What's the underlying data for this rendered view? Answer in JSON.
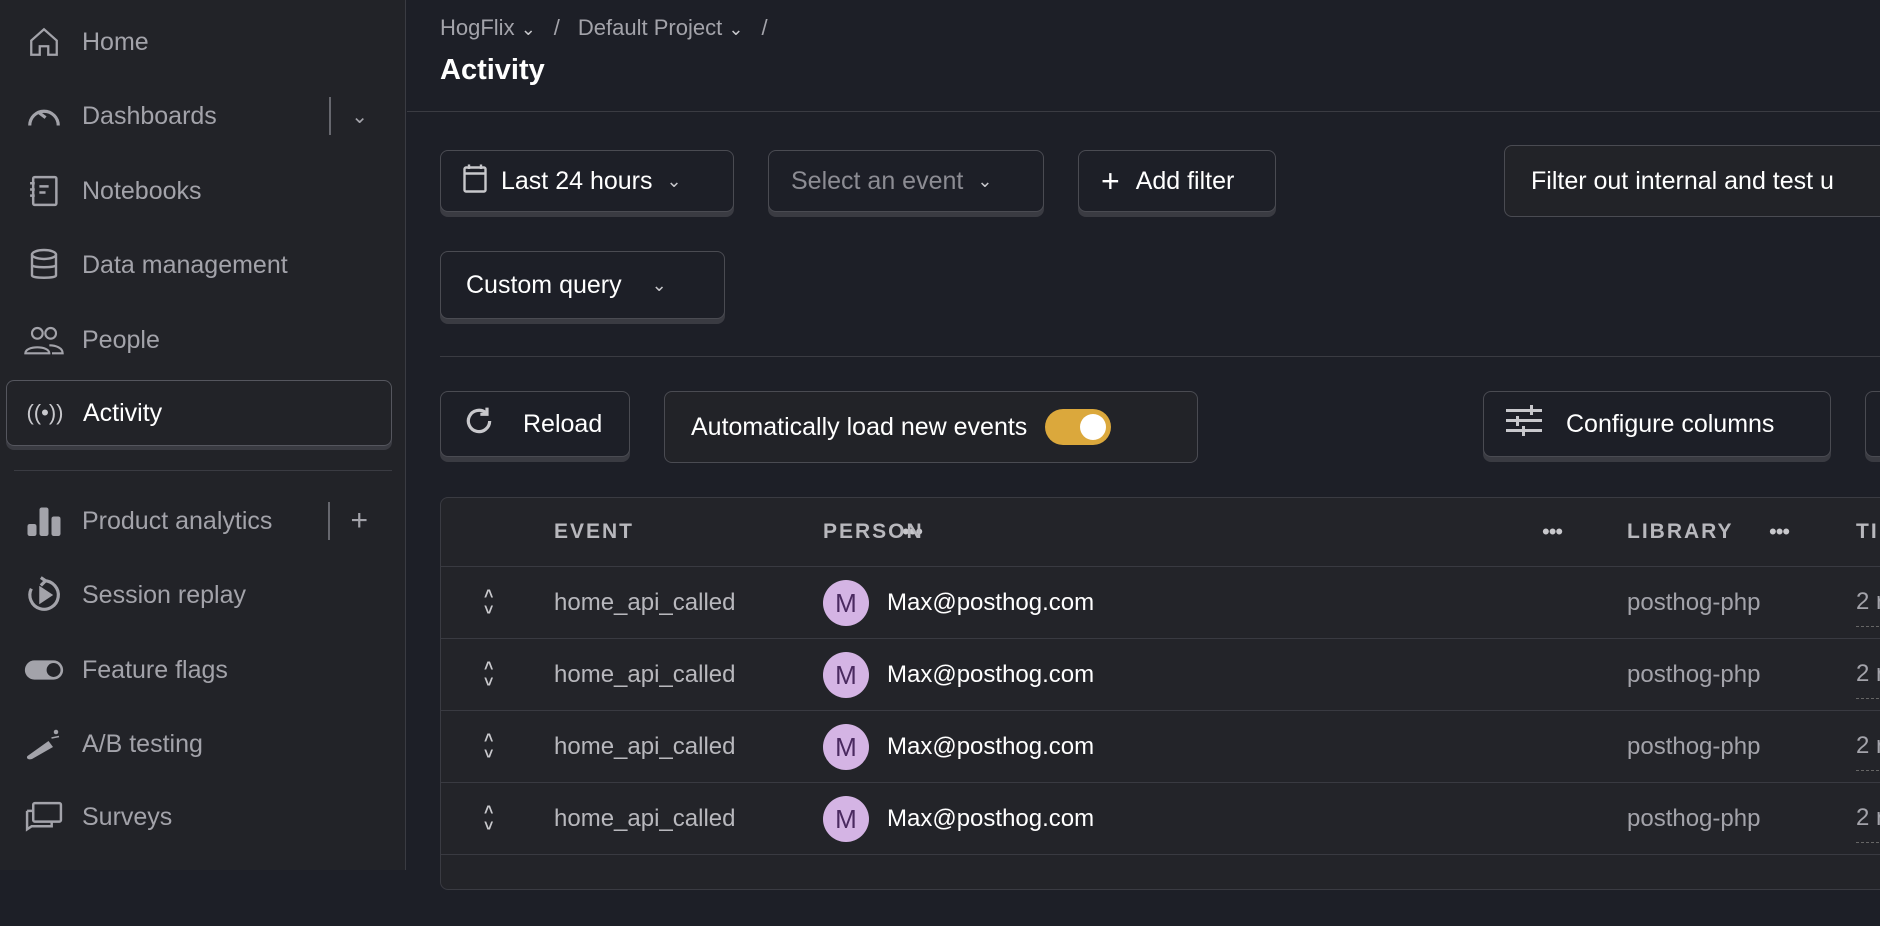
{
  "sidebar": {
    "items": [
      {
        "label": "Home",
        "icon": "home-icon"
      },
      {
        "label": "Dashboards",
        "icon": "gauge-icon"
      },
      {
        "label": "Notebooks",
        "icon": "notebook-icon"
      },
      {
        "label": "Data management",
        "icon": "database-icon"
      },
      {
        "label": "People",
        "icon": "people-icon"
      },
      {
        "label": "Activity",
        "icon": "broadcast-icon",
        "active": true
      },
      {
        "label": "Product analytics",
        "icon": "bar-chart-icon"
      },
      {
        "label": "Session replay",
        "icon": "replay-icon"
      },
      {
        "label": "Feature flags",
        "icon": "toggle-icon"
      },
      {
        "label": "A/B testing",
        "icon": "flask-icon"
      },
      {
        "label": "Surveys",
        "icon": "chat-icon"
      }
    ]
  },
  "header": {
    "breadcrumbs": [
      "HogFlix",
      "Default Project"
    ],
    "separator": "/",
    "title": "Activity"
  },
  "filters": {
    "date_range": "Last 24 hours",
    "event_placeholder": "Select an event",
    "add_filter": "Add filter",
    "internal_filter": "Filter out internal and test u",
    "query_type": "Custom query"
  },
  "toolbar": {
    "reload": "Reload",
    "auto_load": "Automatically load new events",
    "auto_load_on": true,
    "configure_columns": "Configure columns"
  },
  "colors": {
    "accent": "#dba83c",
    "avatar": "#d4b4e4"
  },
  "table": {
    "columns": [
      "EVENT",
      "PERSON",
      "LIBRARY",
      "TI"
    ],
    "rows": [
      {
        "event": "home_api_called",
        "avatar": "M",
        "person": "Max@posthog.com",
        "library": "posthog-php",
        "time": "2 r"
      },
      {
        "event": "home_api_called",
        "avatar": "M",
        "person": "Max@posthog.com",
        "library": "posthog-php",
        "time": "2 r"
      },
      {
        "event": "home_api_called",
        "avatar": "M",
        "person": "Max@posthog.com",
        "library": "posthog-php",
        "time": "2 r"
      },
      {
        "event": "home_api_called",
        "avatar": "M",
        "person": "Max@posthog.com",
        "library": "posthog-php",
        "time": "2 r"
      }
    ]
  }
}
